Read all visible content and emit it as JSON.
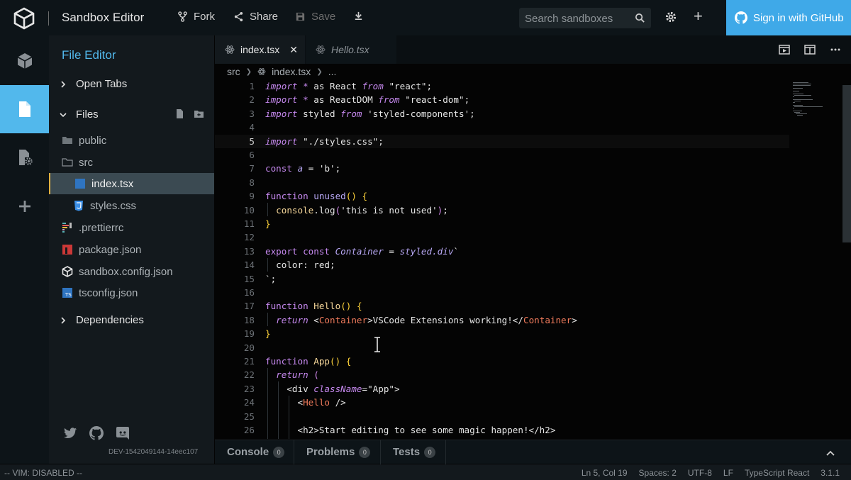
{
  "header": {
    "title": "Sandbox Editor",
    "fork_label": "Fork",
    "share_label": "Share",
    "save_label": "Save",
    "search_placeholder": "Search sandboxes",
    "github_label": "Sign in with GitHub"
  },
  "sidebar": {
    "title": "File Editor",
    "open_tabs_label": "Open Tabs",
    "files_label": "Files",
    "dependencies_label": "Dependencies",
    "tree": [
      {
        "name": "public",
        "icon": "folder-icon"
      },
      {
        "name": "src",
        "icon": "folder-open-icon"
      },
      {
        "name": "index.tsx",
        "icon": "typescript-file-icon",
        "selected": true
      },
      {
        "name": "styles.css",
        "icon": "css-file-icon"
      },
      {
        "name": ".prettierrc",
        "icon": "prettier-file-icon"
      },
      {
        "name": "package.json",
        "icon": "npm-file-icon"
      },
      {
        "name": "sandbox.config.json",
        "icon": "codesandbox-file-icon"
      },
      {
        "name": "tsconfig.json",
        "icon": "tsconfig-file-icon"
      }
    ],
    "dev_id": "DEV-1542049144-14eec107"
  },
  "editor": {
    "tabs": [
      {
        "label": "index.tsx",
        "active": true
      },
      {
        "label": "Hello.tsx",
        "active": false
      }
    ],
    "breadcrumb": {
      "root": "src",
      "file": "index.tsx",
      "more": "..."
    },
    "current_line": 5
  },
  "panel": {
    "tabs": [
      {
        "label": "Console",
        "count": "0"
      },
      {
        "label": "Problems",
        "count": "0"
      },
      {
        "label": "Tests",
        "count": "0"
      }
    ]
  },
  "status": {
    "vim": "-- VIM: DISABLED --",
    "position": "Ln 5, Col 19",
    "spaces": "Spaces: 2",
    "encoding": "UTF-8",
    "eol": "LF",
    "language": "TypeScript React",
    "version": "3.1.1"
  },
  "colors": {
    "accent": "#52b8ec",
    "github_button": "#3fa9e8",
    "selection_border": "#e0b040"
  }
}
